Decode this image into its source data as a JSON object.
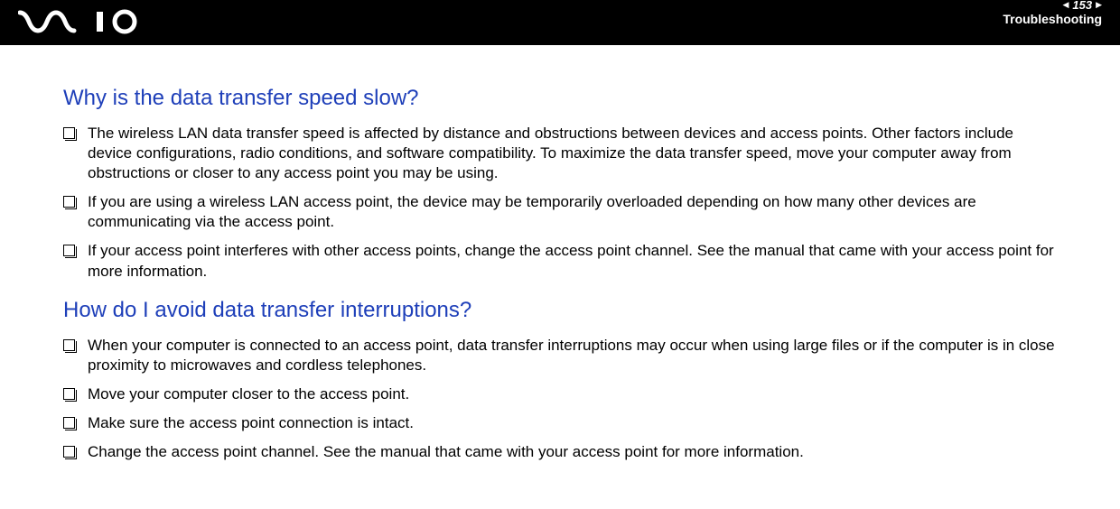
{
  "header": {
    "page_number": "153",
    "section_title": "Troubleshooting"
  },
  "sections": [
    {
      "heading": "Why is the data transfer speed slow?",
      "bullets": [
        "The wireless LAN data transfer speed is affected by distance and obstructions between devices and access points. Other factors include device configurations, radio conditions, and software compatibility. To maximize the data transfer speed, move your computer away from obstructions or closer to any access point you may be using.",
        "If you are using a wireless LAN access point, the device may be temporarily overloaded depending on how many other devices are communicating via the access point.",
        "If your access point interferes with other access points, change the access point channel. See the manual that came with your access point for more information."
      ]
    },
    {
      "heading": "How do I avoid data transfer interruptions?",
      "bullets": [
        "When your computer is connected to an access point, data transfer interruptions may occur when using large files or if the computer is in close proximity to microwaves and cordless telephones.",
        "Move your computer closer to the access point.",
        "Make sure the access point connection is intact.",
        "Change the access point channel. See the manual that came with your access point for more information."
      ]
    }
  ]
}
